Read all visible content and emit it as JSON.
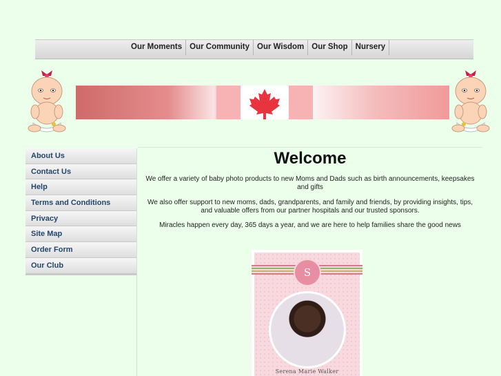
{
  "top_nav": {
    "items": [
      "Our Moments",
      "Our Community",
      "Our Wisdom",
      "Our Shop",
      "Nursery"
    ]
  },
  "sidebar": {
    "items": [
      "About Us",
      "Contact Us",
      "Help",
      "Terms and Conditions",
      "Privacy",
      "Site Map",
      "Order Form",
      "Our Club"
    ]
  },
  "main": {
    "title": "Welcome",
    "paragraphs": [
      "We offer a variety of baby photo products to new Moms and Dads such as birth announcements, keepsakes and gifts",
      "We also offer support to new moms, dads, grandparents, and family and friends, by providing insights, tips, and valuable offers from our partner hospitals and our trusted sponsors.",
      "Miracles happen every day, 365 days a year, and we are here to help families share the good news"
    ]
  },
  "card": {
    "monogram": "S",
    "caption": "Serena Marie Walker"
  },
  "colors": {
    "page_bg": "#ebffeb",
    "nav_text": "#222222",
    "sidebar_text": "#24456b",
    "flag_red": "#e8343f"
  },
  "icons": {
    "banner_flag": "canada-flag-icon",
    "maple_leaf": "maple-leaf-icon",
    "baby": "baby-illustration-icon"
  }
}
